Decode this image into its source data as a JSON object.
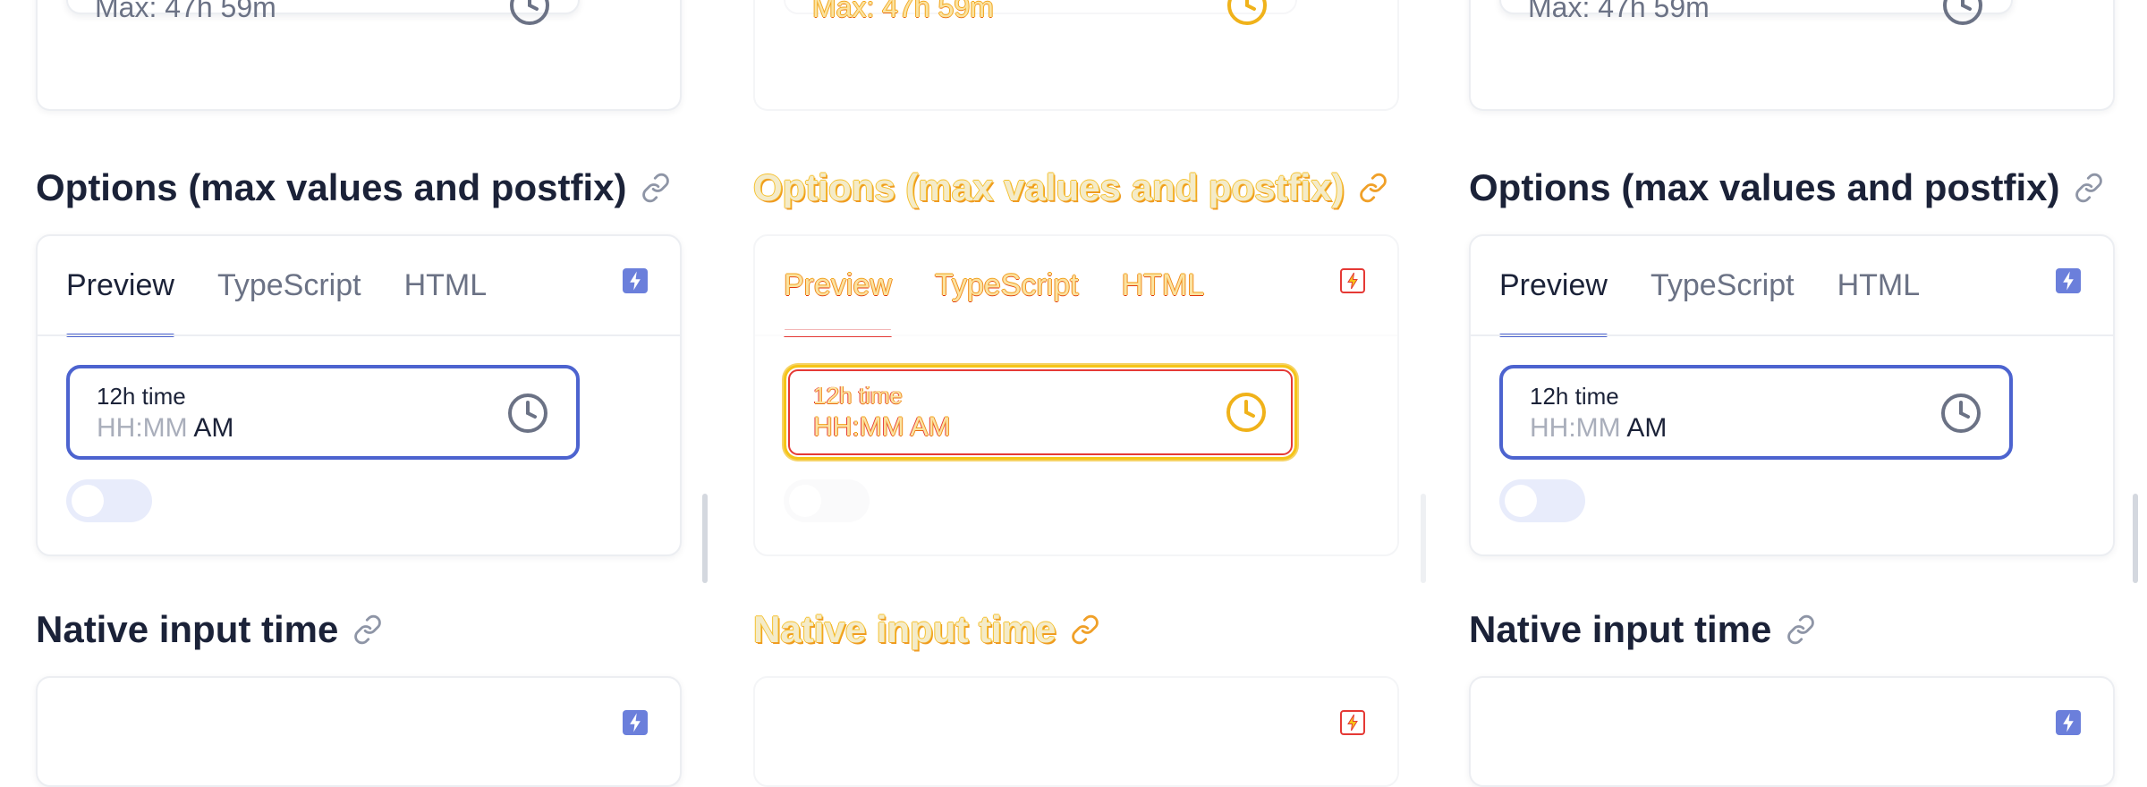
{
  "panes": [
    {
      "max_field_text": "Max: 47h 59m",
      "section_title": "Options (max values and postfix)",
      "tabs": [
        "Preview",
        "TypeScript",
        "HTML"
      ],
      "active_tab": "Preview",
      "time_field": {
        "label": "12h time",
        "placeholder": "HH:MM",
        "postfix": "AM"
      },
      "toggle_checked": false,
      "next_section_title": "Native input time"
    },
    {
      "max_field_text": "Max: 47h 59m",
      "section_title": "Options (max values and postfix)",
      "tabs": [
        "Preview",
        "TypeScript",
        "HTML"
      ],
      "active_tab": "Preview",
      "time_field": {
        "label": "12h time",
        "placeholder": "HH:MM",
        "postfix": "AM"
      },
      "toggle_checked": false,
      "next_section_title": "Native input time"
    },
    {
      "max_field_text": "Max: 47h 59m",
      "section_title": "Options (max values and postfix)",
      "tabs": [
        "Preview",
        "TypeScript",
        "HTML"
      ],
      "active_tab": "Preview",
      "time_field": {
        "label": "12h time",
        "placeholder": "HH:MM",
        "postfix": "AM"
      },
      "toggle_checked": false,
      "next_section_title": "Native input time"
    }
  ],
  "icons": {
    "clock": "clock-icon",
    "link": "link-icon",
    "bolt": "bolt-icon"
  },
  "colors": {
    "accent": "#4c63cf",
    "heading": "#1b2238",
    "muted": "#6b7285",
    "placeholder": "#a9aebb",
    "toggle_track": "#e8ecfb",
    "diff_yellow": "#f5c518",
    "diff_red": "#e53935",
    "diff_orange": "#f08a1c"
  }
}
